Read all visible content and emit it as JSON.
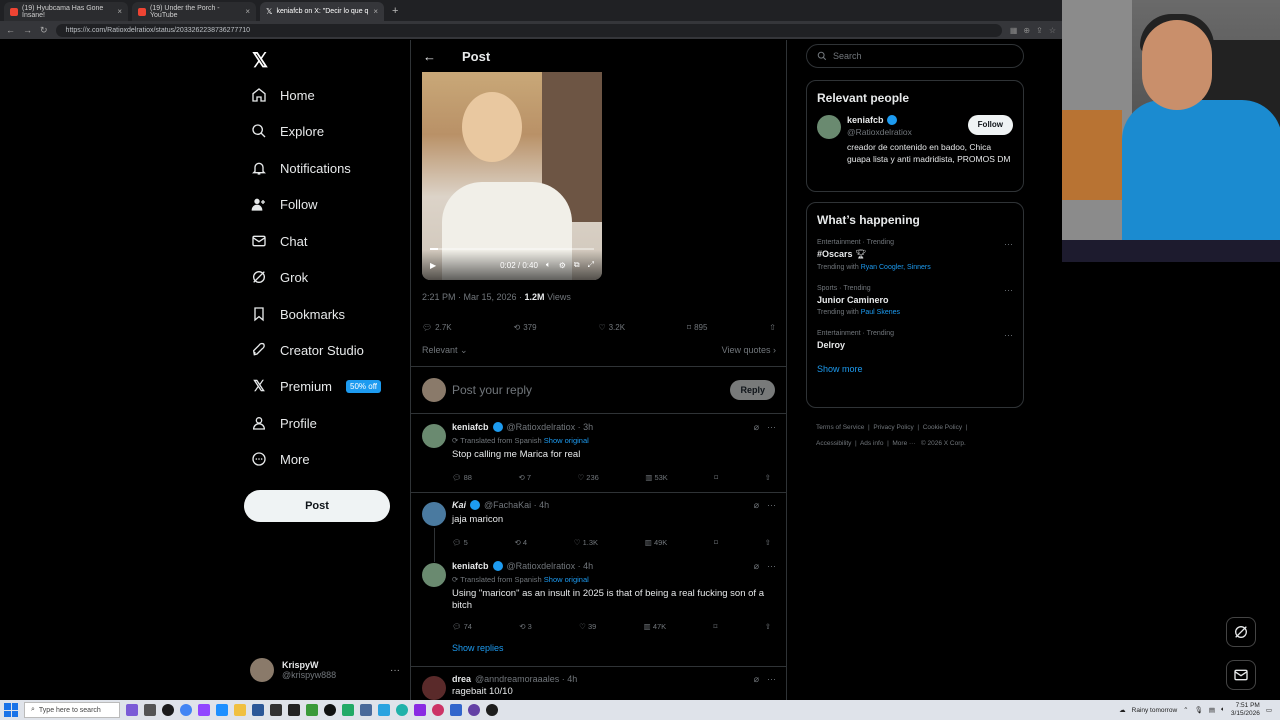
{
  "browser": {
    "tabs": [
      {
        "label": "(19) Hyubcama Has Gone Insane!"
      },
      {
        "label": "(19) Under the Porch - YouTube"
      },
      {
        "label": "keniafcb on X: \"Decir lo que q"
      }
    ],
    "url": "https://x.com/Ratioxdelratiox/status/2033262238736277710"
  },
  "nav": {
    "items": [
      {
        "label": "Home"
      },
      {
        "label": "Explore"
      },
      {
        "label": "Notifications"
      },
      {
        "label": "Follow"
      },
      {
        "label": "Chat"
      },
      {
        "label": "Grok"
      },
      {
        "label": "Bookmarks"
      },
      {
        "label": "Creator Studio"
      },
      {
        "label": "Premium"
      },
      {
        "label": "Profile"
      },
      {
        "label": "More"
      }
    ],
    "premium_badge": "50% off",
    "post_button": "Post"
  },
  "account": {
    "name": "KrispyW",
    "handle": "@krispyw888"
  },
  "post": {
    "header_title": "Post",
    "video_time": "0:02 / 0:40",
    "video_progress": 0.05,
    "time": "2:21 PM · Mar 15, 2026 · ",
    "views_count": "1.2M",
    "views_label": " Views",
    "stats": {
      "replies": "2.7K",
      "reposts": "379",
      "likes": "3.2K",
      "bookmarks": "895"
    },
    "sort_label": "Relevant",
    "view_quotes": "View quotes",
    "reply_placeholder": "Post your reply",
    "reply_button": "Reply"
  },
  "replies": [
    {
      "name": "keniafcb",
      "handle": "@Ratioxdelratiox · 3h",
      "translated": "Translated from Spanish",
      "show_original": "Show original",
      "text": "Stop calling me Marica for real",
      "replies": "88",
      "reposts": "7",
      "likes": "236",
      "views": "53K"
    },
    {
      "name": "Kai",
      "handle": "@FachaKai · 4h",
      "text": "jaja maricon",
      "replies": "5",
      "reposts": "4",
      "likes": "1.3K",
      "views": "49K"
    },
    {
      "name": "keniafcb",
      "handle": "@Ratioxdelratiox · 4h",
      "translated": "Translated from Spanish",
      "show_original": "Show original",
      "text": "Using \"maricon\" as an insult in 2025 is that of being a real fucking son of a bitch",
      "replies": "74",
      "reposts": "3",
      "likes": "39",
      "views": "47K",
      "show_replies": "Show replies"
    },
    {
      "name": "drea",
      "handle": "@anndreamoraaales · 4h",
      "text": "ragebait 10/10"
    }
  ],
  "right": {
    "search_placeholder": "Search",
    "relevant_title": "Relevant people",
    "person": {
      "name": "keniafcb",
      "handle": "@Ratioxdelratiox",
      "follow": "Follow",
      "bio": "creador de contenido en badoo, Chica guapa lista y anti madridista, PROMOS DM"
    },
    "happening_title": "What’s happening",
    "trends": [
      {
        "category": "Entertainment · Trending",
        "title": "#Oscars",
        "with_label": "Trending with ",
        "with": "Ryan Coogler, Sinners"
      },
      {
        "category": "Sports · Trending",
        "title": "Junior Caminero",
        "with_label": "Trending with ",
        "with": "Paul Skenes"
      },
      {
        "category": "Entertainment · Trending",
        "title": "Delroy"
      }
    ],
    "show_more": "Show more",
    "footer": [
      "Terms of Service",
      "Privacy Policy",
      "Cookie Policy",
      "Accessibility",
      "Ads info",
      "More ···",
      "© 2026 X Corp."
    ]
  },
  "taskbar": {
    "search_placeholder": "Type here to search",
    "weather": "Rainy tomorrow",
    "time": "7:51 PM",
    "date": "3/15/2026"
  },
  "colors": {
    "accent": "#1d9bf0",
    "background": "#000000",
    "text": "#e7e9ea",
    "muted": "#71767b"
  }
}
